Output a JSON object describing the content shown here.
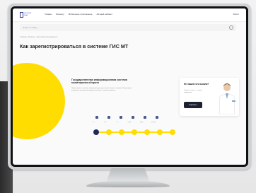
{
  "header": {
    "logo_text": "ЧЕСТНЫЙ ЗНАК",
    "nav": [
      "Товары",
      "Бизнесу",
      "Мобильное приложение",
      "Личный кабинет"
    ],
    "login": "Войти"
  },
  "search": {
    "placeholder": "Поиск по сайту"
  },
  "breadcrumb": "Главная › Бизнесу › Как зарегистрироваться",
  "page_title": "Как зарегистрироваться в системе ГИС МТ",
  "hero": {
    "title": "Государственная информационная система мониторинга оборота",
    "text": "Подключение к системе маркировки для участников оборота товаров. Регистрация, получение электронной подписи и работа в личном кабинете."
  },
  "steps": [
    "ЭП",
    "Рег.",
    "ЛК",
    "Коды",
    "Ввод",
    "Вывод"
  ],
  "help_card": {
    "question": "Не нашли что искали?",
    "subtitle": "Задайте вопрос в службу поддержки",
    "button": "Спросить"
  },
  "colors": {
    "accent": "#ffdd00",
    "dark": "#1d2230",
    "brand": "#2d3b8f"
  }
}
